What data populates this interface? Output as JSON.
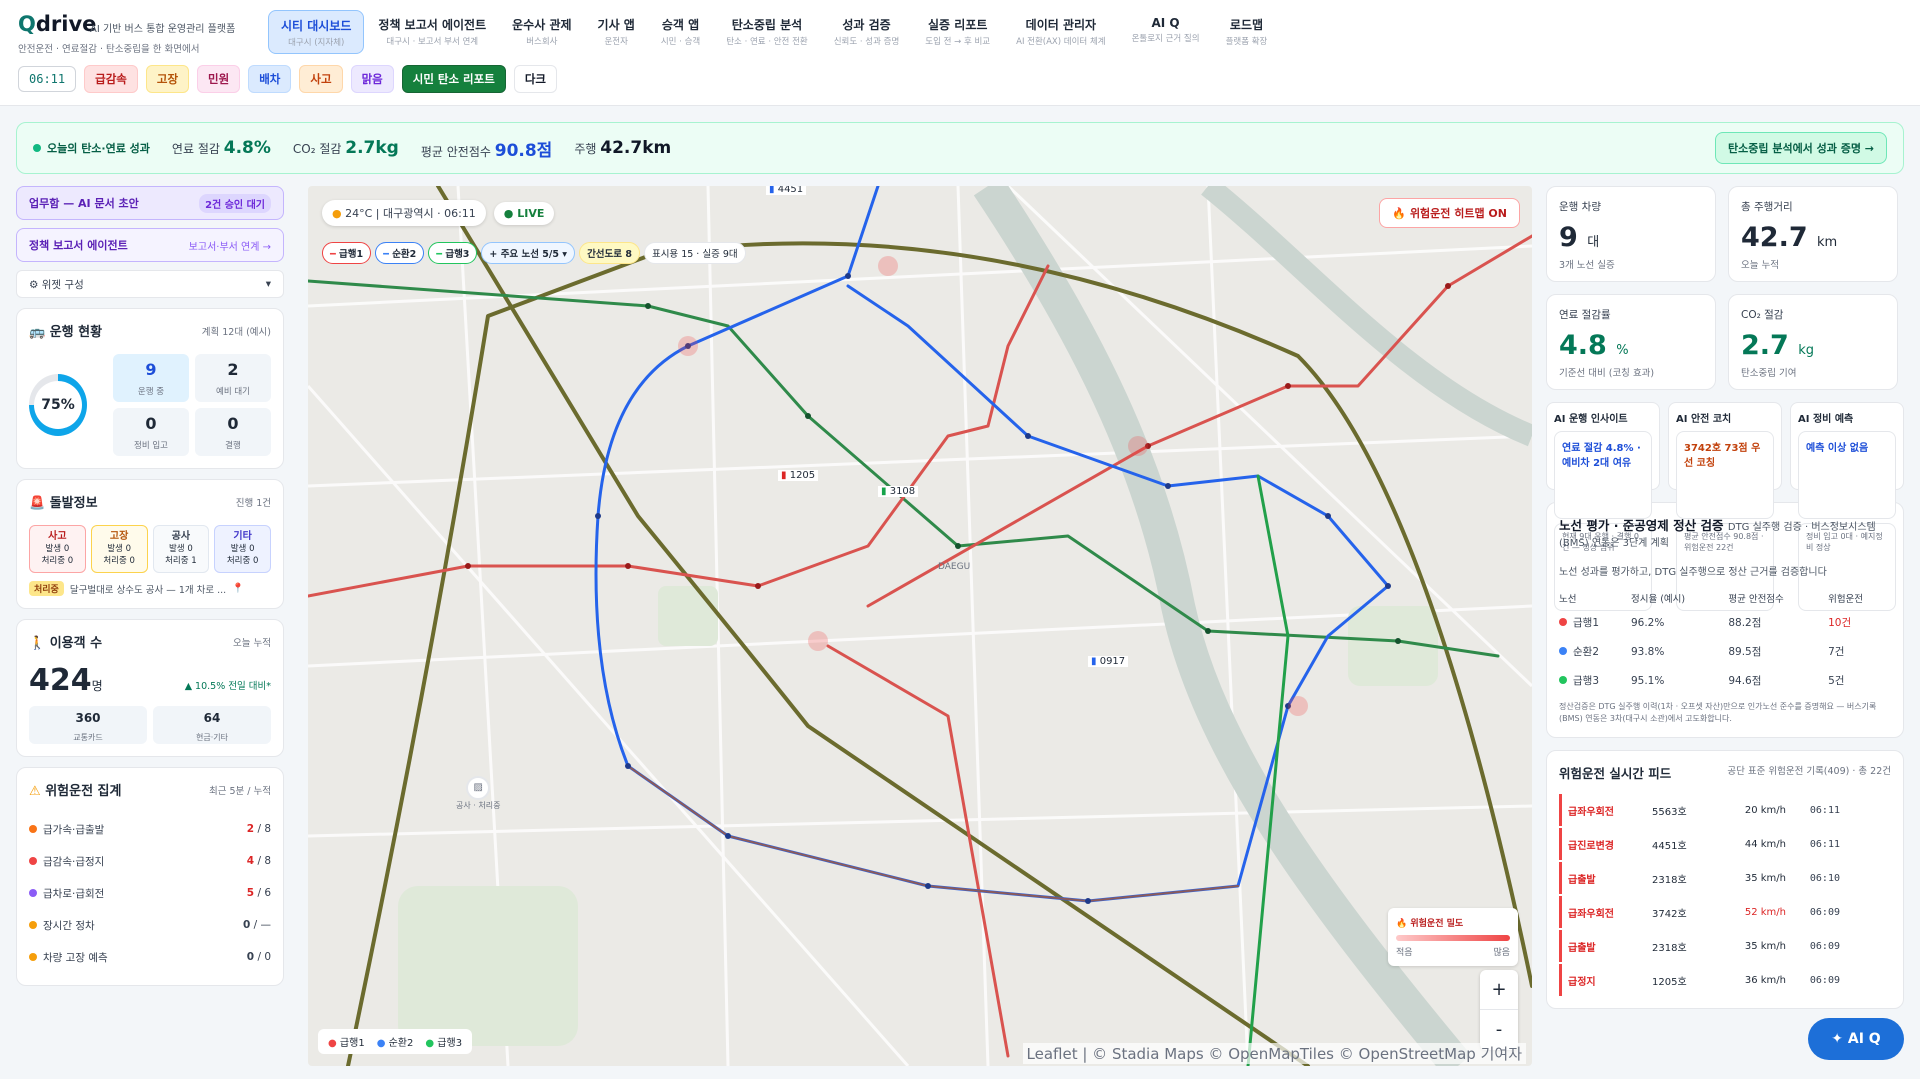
{
  "brand": {
    "logo_a": "Q",
    "logo_b": "drive",
    "tagline": "AI 기반 버스 통합 운영관리 플랫폼",
    "sub": "안전운전 · 연료절감 · 탄소중립을 한 화면에서"
  },
  "nav": [
    {
      "label": "시티 대시보드",
      "sub": "대구시 (지자체)",
      "active": true
    },
    {
      "label": "정책 보고서 에이전트",
      "sub": "대구시 · 보고서 부서 연계"
    },
    {
      "label": "운수사 관제",
      "sub": "버스회사"
    },
    {
      "label": "기사 앱",
      "sub": "운전자"
    },
    {
      "label": "승객 앱",
      "sub": "시민 · 승객"
    },
    {
      "label": "탄소중립 분석",
      "sub": "탄소 · 연료 · 안전 전환"
    },
    {
      "label": "성과 검증",
      "sub": "신뢰도 · 성과 증명"
    },
    {
      "label": "실증 리포트",
      "sub": "도입 전 → 후 비교"
    },
    {
      "label": "데이터 관리자",
      "sub": "AI 전환(AX) 데이터 체계"
    },
    {
      "label": "AI Q",
      "sub": "온톨로지 근거 질의"
    },
    {
      "label": "로드맵",
      "sub": "플랫폼 확장"
    }
  ],
  "toolbar": {
    "clock": "06:11",
    "chips": [
      "급감속",
      "고장",
      "민원",
      "배차",
      "사고",
      "맑음"
    ],
    "report": "시민 탄소 리포트",
    "dark": "다크"
  },
  "kpibar": {
    "title": "오늘의 탄소·연료 성과",
    "fuel_label": "연료 절감",
    "fuel": "4.8%",
    "co2_label": "CO₂ 절감",
    "co2": "2.7kg",
    "safety_label": "평균 안전점수",
    "safety": "90.8점",
    "dist_label": "주행",
    "dist": "42.7km",
    "cta": "탄소중립 분석에서 성과 증명 →"
  },
  "left": {
    "pill1": "업무함 — AI 문서 초안",
    "pill1_tag": "2건 승인 대기",
    "pill2": "정책 보고서 에이전트",
    "pill2_tag": "보고서·부서 연계 →",
    "widget": "⚙ 위젯 구성",
    "ops": {
      "title": "운행 현황",
      "right": "계획 12대 (예시)",
      "pct": "75%",
      "running": "9",
      "running_l": "운행 중",
      "standby": "2",
      "standby_l": "예비 대기",
      "maint": "0",
      "maint_l": "정비 입고",
      "fault": "0",
      "fault_l": "결행"
    },
    "incident": {
      "title": "돌발정보",
      "right": "진행 1건",
      "cells": [
        {
          "h": "사고",
          "a": "발생 0",
          "b": "처리중 0"
        },
        {
          "h": "고장",
          "a": "발생 0",
          "b": "처리중 0"
        },
        {
          "h": "공사",
          "a": "발생 0",
          "b": "처리중 1"
        },
        {
          "h": "기타",
          "a": "발생 0",
          "b": "처리중 0"
        }
      ],
      "tag": "처리중",
      "note": "달구벌대로 상수도 공사 — 1개 차로 ..."
    },
    "pax": {
      "title": "이용객 수",
      "right": "오늘 누적",
      "value": "424",
      "unit": "명",
      "delta": "▲ 10.5% 전일 대비*",
      "card": "360",
      "card_l": "교통카드",
      "cash": "64",
      "cash_l": "현금·기타"
    },
    "risk": {
      "title": "위험운전 집계",
      "right": "최근 5분 / 누적",
      "rows": [
        {
          "l": "급가속·급출발",
          "v": "2",
          "t": "/ 8",
          "c": "#f97316"
        },
        {
          "l": "급감속·급정지",
          "v": "4",
          "t": "/ 8",
          "c": "#ef4444"
        },
        {
          "l": "급차로·급회전",
          "v": "5",
          "t": "/ 6",
          "c": "#8b5cf6"
        },
        {
          "l": "장시간 정차",
          "v": "0",
          "t": "/ —",
          "c": "#f59e0b"
        },
        {
          "l": "차량 고장 예측",
          "v": "0",
          "t": "/ 0",
          "c": "#f59e0b"
        }
      ]
    }
  },
  "map": {
    "weather": "24°C",
    "city": "대구광역시 · 06:11",
    "live": "LIVE",
    "heat": "위험운전 히트맵 ON",
    "routes": [
      "급행1",
      "순환2",
      "급행3",
      "+ 주요 노선 5/5",
      "간선도로 8",
      "표시용 15 · 실증 9대"
    ],
    "buses": [
      "4451",
      "1205",
      "3108",
      "0917"
    ],
    "construction": "공사 · 처리중",
    "center": "DAEGU",
    "legend": [
      "급행1",
      "순환2",
      "급행3"
    ],
    "heat_title": "위험운전 밀도",
    "heat_lo": "적음",
    "heat_hi": "많음",
    "attribution": "Leaflet | © Stadia Maps © OpenMapTiles © OpenStreetMap 기여자"
  },
  "right": {
    "cards": [
      {
        "t": "운행 차량",
        "v": "9",
        "u": "대",
        "n": "3개 노선 실증"
      },
      {
        "t": "총 주행거리",
        "v": "42.7",
        "u": "km",
        "n": "오늘 누적"
      },
      {
        "t": "연료 절감률",
        "v": "4.8",
        "u": "%",
        "n": "기준선 대비 (코칭 효과)"
      },
      {
        "t": "CO₂ 절감",
        "v": "2.7",
        "u": "kg",
        "n": "탄소중립 기여"
      }
    ],
    "ai": [
      {
        "t": "AI 운행 인사이트",
        "m": "연료 절감 4.8% · 예비차 2대 여유",
        "s": "현재 9대 운행 · 결행 0건 — 정상 범위"
      },
      {
        "t": "AI 안전 코치",
        "m": "3742호 73점 우선 코칭",
        "s": "평균 안전점수 90.8점 · 위험운전 22건"
      },
      {
        "t": "AI 정비 예측",
        "m": "예측 이상 없음",
        "s": "정비 입고 0대 · 예지정비 정상"
      }
    ],
    "eval": {
      "title": "노선 평가 · 준공영제 정산 검증",
      "sub": "DTG 실주행 검증 · 버스정보시스템(BMS) 연동은 3단계 계획",
      "desc": "노선 성과를 평가하고, DTG 실주행으로 정산 근거를 검증합니다",
      "cols": [
        "노선",
        "정시율 (예시)",
        "평균 안전점수",
        "위험운전"
      ],
      "rows": [
        {
          "r": "급행1",
          "c": "#ef4444",
          "a": "96.2%",
          "b": "88.2점",
          "d": "10건"
        },
        {
          "r": "순환2",
          "c": "#3b82f6",
          "a": "93.8%",
          "b": "89.5점",
          "d": "7건"
        },
        {
          "r": "급행3",
          "c": "#22c55e",
          "a": "95.1%",
          "b": "94.6점",
          "d": "5건"
        }
      ],
      "foot": "정산검증은 DTG 실주행 이력(1차 · 오프셋 자산)만으로 인가노선 준수를 증명해요 — 버스기록(BMS) 연동은 3차(대구시 소관)에서 고도화합니다."
    },
    "feed": {
      "title": "위험운전 실시간 피드",
      "sub": "공단 표준 위험운전 기록(409) · 총 22건",
      "rows": [
        {
          "t": "급좌우회전",
          "b": "5563호",
          "s": "20 km/h",
          "tm": "06:11"
        },
        {
          "t": "급진로변경",
          "b": "4451호",
          "s": "44 km/h",
          "tm": "06:11"
        },
        {
          "t": "급출발",
          "b": "2318호",
          "s": "35 km/h",
          "tm": "06:10"
        },
        {
          "t": "급좌우회전",
          "b": "3742호",
          "s": "52 km/h",
          "tm": "06:09"
        },
        {
          "t": "급출발",
          "b": "2318호",
          "s": "35 km/h",
          "tm": "06:09"
        },
        {
          "t": "급정지",
          "b": "1205호",
          "s": "36 km/h",
          "tm": "06:09"
        }
      ]
    }
  },
  "aiq": "AI Q"
}
